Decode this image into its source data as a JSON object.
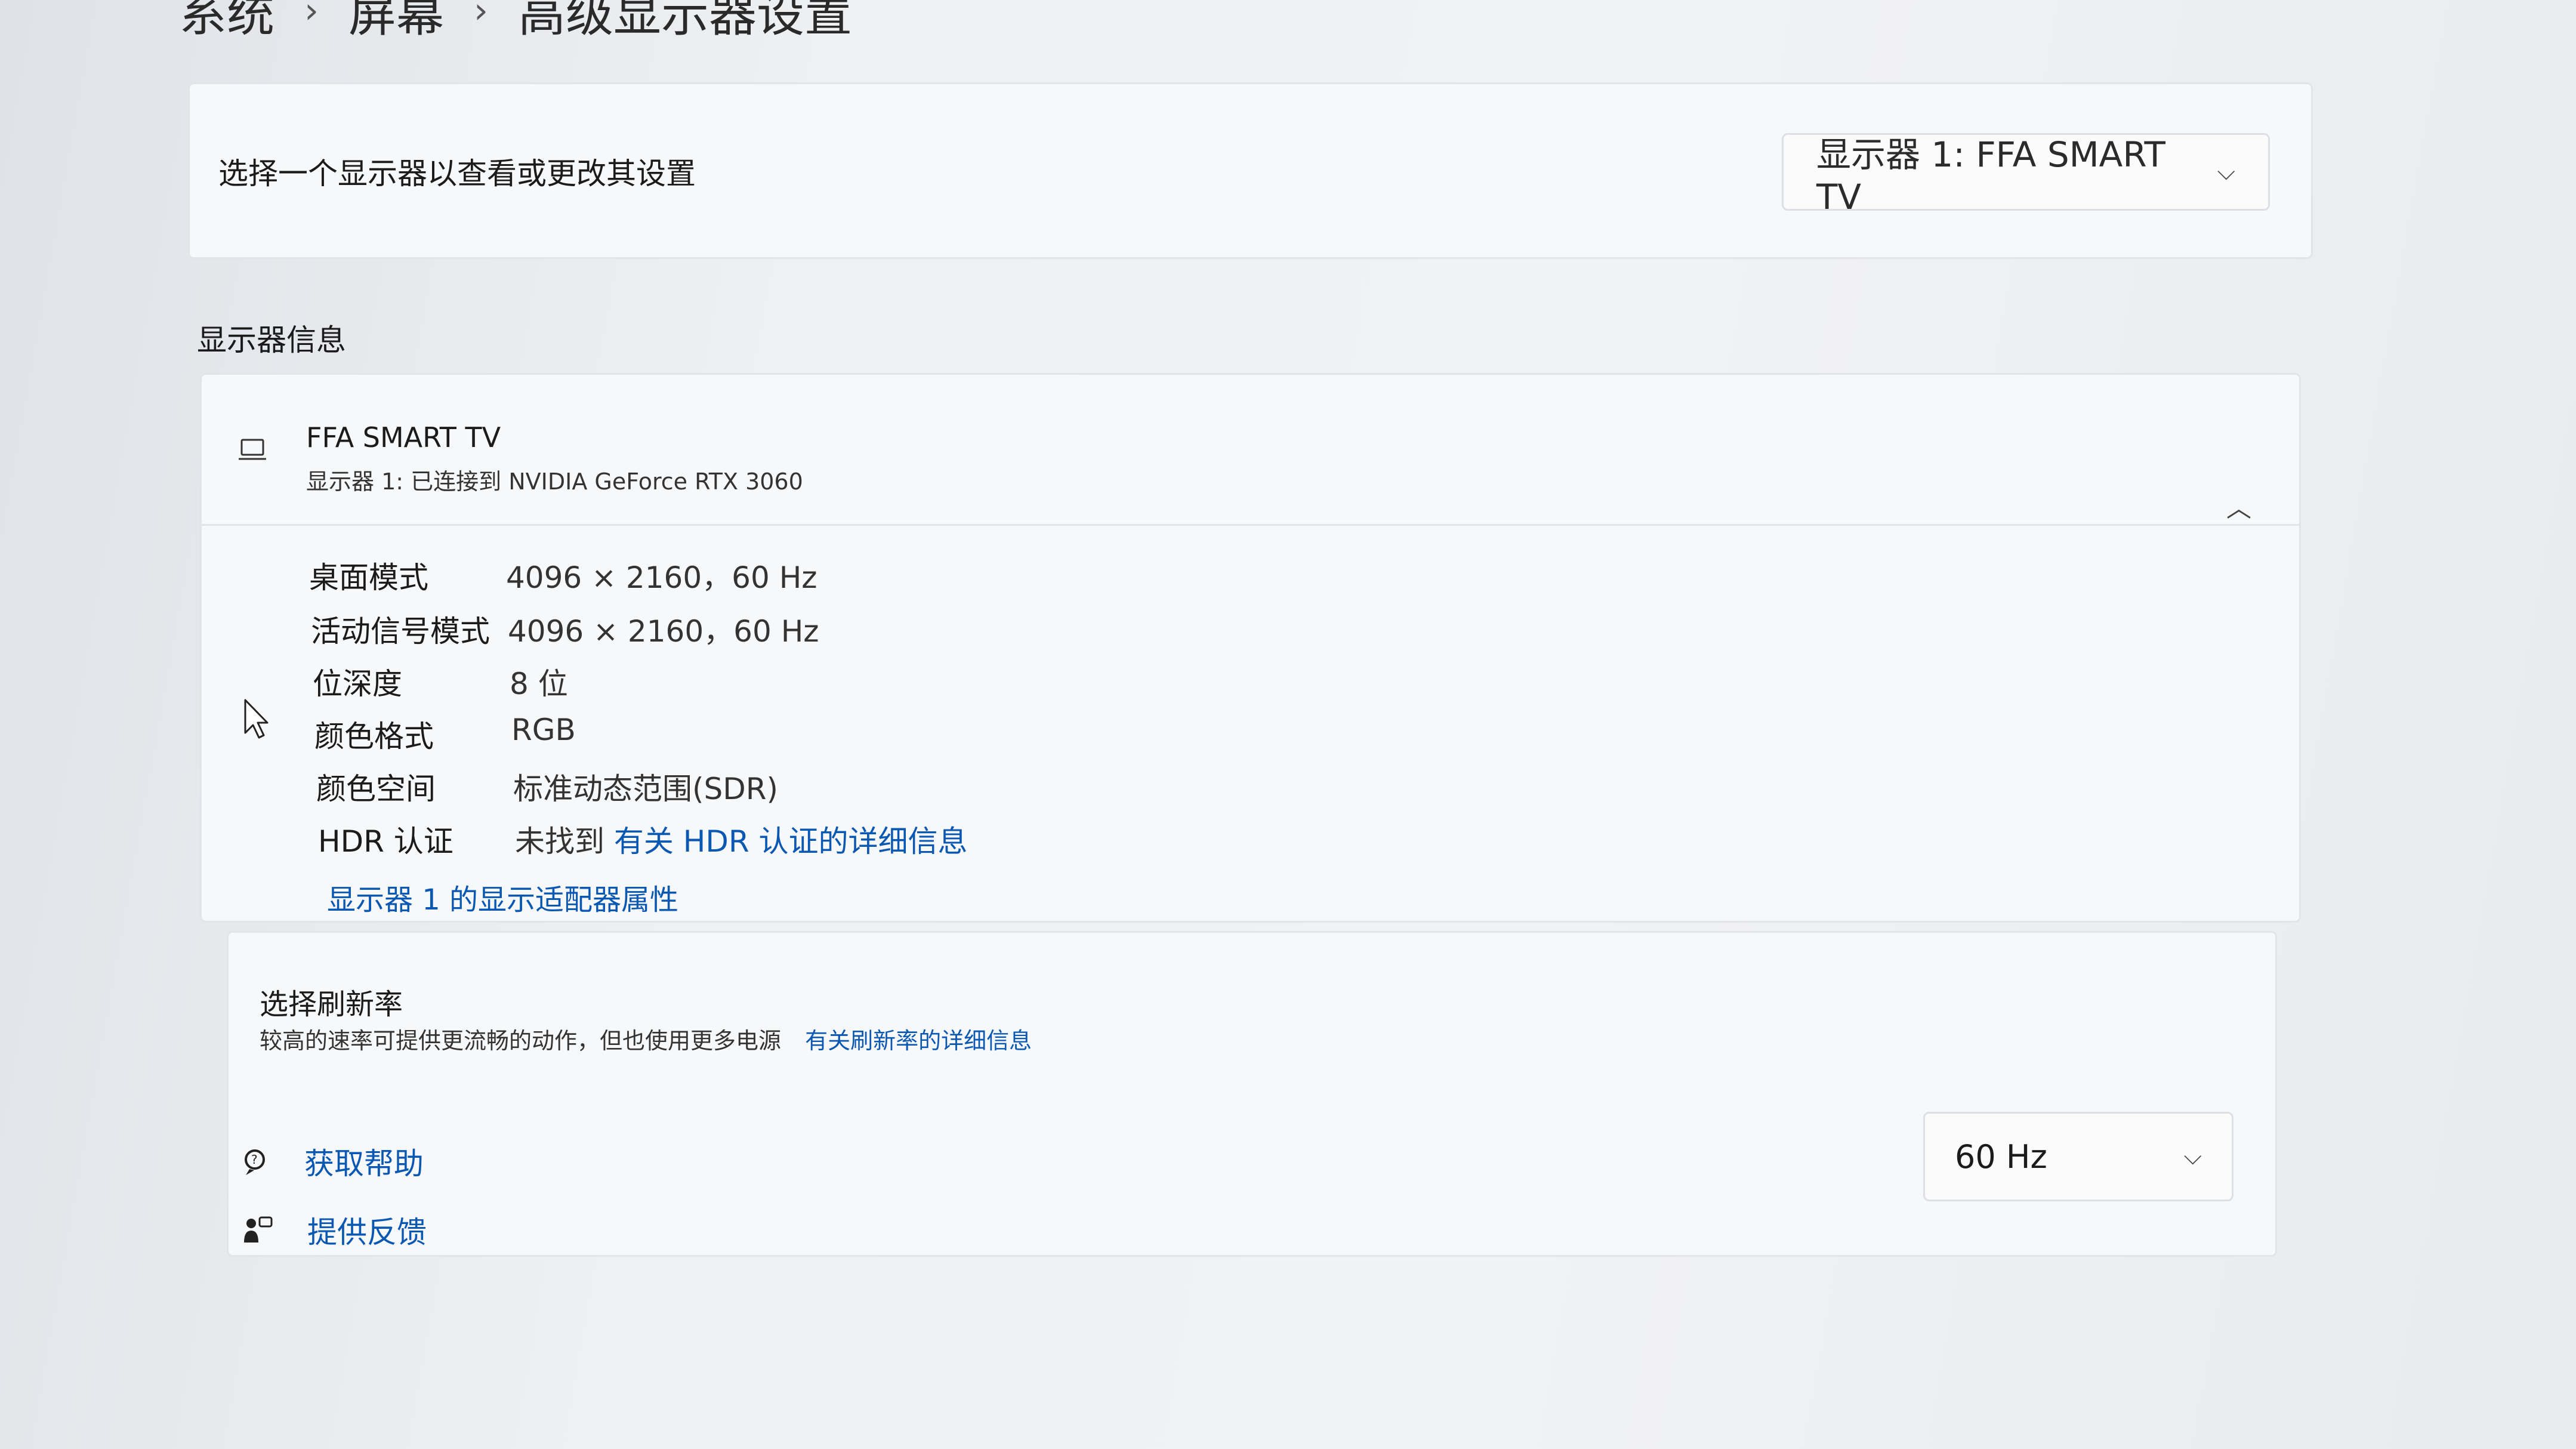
{
  "breadcrumb": {
    "items": [
      "系统",
      "屏幕",
      "高级显示器设置"
    ],
    "separator": "›"
  },
  "display_select": {
    "label": "选择一个显示器以查看或更改其设置",
    "selected": "显示器 1: FFA SMART TV"
  },
  "display_info": {
    "section_title": "显示器信息",
    "monitor_name": "FFA SMART TV",
    "monitor_sub": "显示器 1: 已连接到 NVIDIA GeForce RTX 3060",
    "rows": [
      {
        "key": "桌面模式",
        "value": "4096 × 2160，60 Hz"
      },
      {
        "key": "活动信号模式",
        "value": "4096 × 2160，60 Hz"
      },
      {
        "key": "位深度",
        "value": "8 位"
      },
      {
        "key": "颜色格式",
        "value": "RGB"
      },
      {
        "key": "颜色空间",
        "value": "标准动态范围(SDR)"
      }
    ],
    "hdr": {
      "key": "HDR 认证",
      "value": "未找到",
      "link": "有关 HDR 认证的详细信息"
    },
    "adapter_link": "显示器 1 的显示适配器属性"
  },
  "refresh": {
    "title": "选择刷新率",
    "description": "较高的速率可提供更流畅的动作，但也使用更多电源",
    "link": "有关刷新率的详细信息",
    "selected": "60 Hz"
  },
  "footer": {
    "help": "获取帮助",
    "feedback": "提供反馈"
  },
  "colors": {
    "link": "#0b58b3",
    "card": "#f7f8f9",
    "background": "#eef0f2"
  },
  "icons": [
    "laptop-icon",
    "chevron-down-icon",
    "chevron-up-icon",
    "help-icon",
    "feedback-icon",
    "cursor-icon"
  ]
}
